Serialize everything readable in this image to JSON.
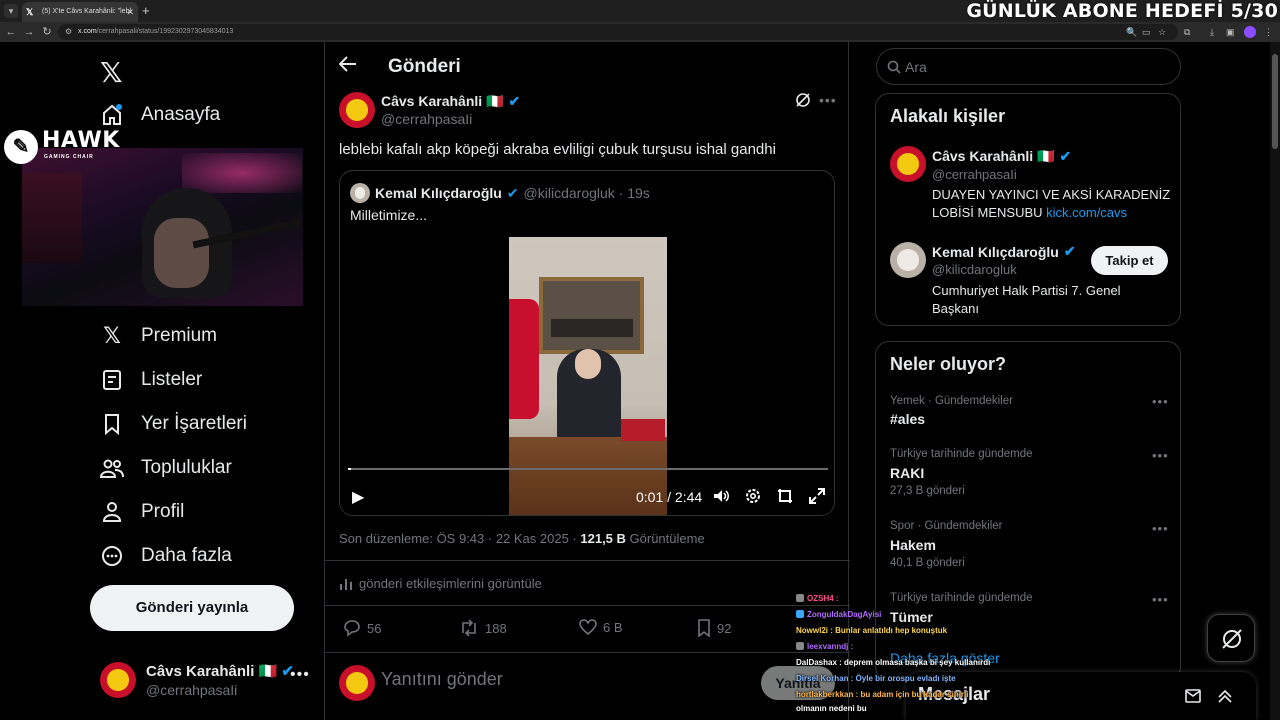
{
  "browser": {
    "tab_title": "(5) X'te Câvs Karahânli: \"lebl",
    "url_host": "x.com",
    "url_path": "/cerrahpasali/status/1992302973045834013"
  },
  "stream_overlay": {
    "goal_text": "GÜNLÜK ABONE HEDEFİ 5/30",
    "sponsor_title": "HAWK",
    "sponsor_subtitle": "GAMING CHAIR"
  },
  "nav": {
    "home": "Anasayfa",
    "premium": "Premium",
    "lists": "Listeler",
    "bookmarks": "Yer İşaretleri",
    "communities": "Topluluklar",
    "profile": "Profil",
    "more": "Daha fazla",
    "post_button": "Gönderi yayınla",
    "account_name": "Câvs Karahânli 🇮🇹",
    "account_handle": "@cerrahpasaIi"
  },
  "main": {
    "title": "Gönderi",
    "author_name": "Câvs Karahânli 🇮🇹",
    "author_handle": "@cerrahpasaIi",
    "text": "leblebi kafalı akp köpeği akraba evliligi çubuk turşusu ishal gandhi",
    "quote": {
      "name": "Kemal Kılıçdaroğlu",
      "handle": "@kilicdarogluk · 19s",
      "text": "Milletimize...",
      "video_time": "0:01 / 2:44",
      "progress_fraction": 0.006
    },
    "edited": "Son düzenleme: ÖS 9:43 · 22 Kas 2025 · ",
    "views_count": "121,5 B",
    "views_label": " Görüntüleme",
    "engagements": "gönderi etkileşimlerini görüntüle",
    "replies": "56",
    "reposts": "188",
    "likes": "6 B",
    "bookmarks": "92",
    "reply_placeholder": "Yanıtını gönder",
    "reply_button": "Yanıtla"
  },
  "sidebar": {
    "search_placeholder": "Ara",
    "related_title": "Alakalı kişiler",
    "people": [
      {
        "name": "Câvs Karahânli 🇮🇹",
        "handle": "@cerrahpasaIi",
        "bio": "DUAYEN YAYINCI VE AKSİ KARADENİZ LOBİSİ MENSUBU ",
        "link": "kick.com/cavs"
      },
      {
        "name": "Kemal Kılıçdaroğlu",
        "handle": "@kilicdarogluk",
        "bio": "Cumhuriyet Halk Partisi 7. Genel Başkanı",
        "follow": "Takip et"
      }
    ],
    "trends_title": "Neler oluyor?",
    "trends": [
      {
        "meta": "Yemek · Gündemdekiler",
        "name": "#ales",
        "count": ""
      },
      {
        "meta": "Türkiye tarihinde gündemde",
        "name": "RAKI",
        "count": "27,3 B gönderi"
      },
      {
        "meta": "Spor · Gündemdekiler",
        "name": "Hakem",
        "count": "40,1 B gönderi"
      },
      {
        "meta": "Türkiye tarihinde gündemde",
        "name": "Tümer",
        "count": ""
      }
    ],
    "show_more": "Daha fazla göster",
    "messages": "Mesajlar"
  },
  "chat": [
    {
      "text": "OZSH4 : ",
      "color": "#ff4d8d"
    },
    {
      "text": "ZonguldakDagAyisi",
      "color": "#b36bff"
    },
    {
      "text": "Nowwl2i : Bunlar anlatıldı hep konuştuk",
      "color": "#ffd54d"
    },
    {
      "text": "leexvanndj : ",
      "color": "#b36bff"
    },
    {
      "text": "DalDashax : deprem olmasa başka bi şey kullanırdı",
      "color": "#ffffff"
    },
    {
      "text": "Dirsel Korhan : Öyle bir orospu evladı işte",
      "color": "#7fb6ff"
    },
    {
      "text": "hortlakberkkan : bu adam için bu kadar sinirli",
      "color": "#ffb84d"
    },
    {
      "text": "olmanın nedeni bu",
      "color": "#ffffff"
    }
  ],
  "colors": {
    "accent": "#1d9bf0",
    "verified": "#1d9bf0",
    "text": "#e7e9ea",
    "muted": "#71767b",
    "border": "#2f3336"
  }
}
